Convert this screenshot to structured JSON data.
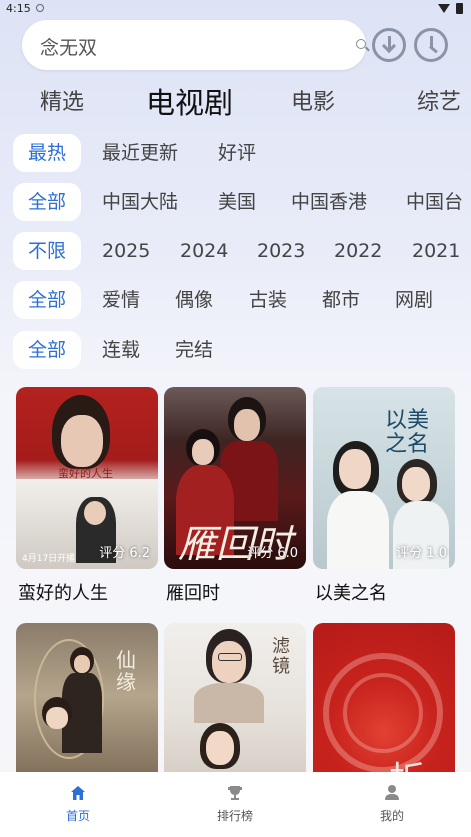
{
  "status": {
    "time": "4:15"
  },
  "search": {
    "value": "念无双"
  },
  "tabs": [
    {
      "label": "精选"
    },
    {
      "label": "电视剧"
    },
    {
      "label": "电影"
    },
    {
      "label": "综艺"
    }
  ],
  "filters": {
    "sort": [
      "最热",
      "最近更新",
      "好评"
    ],
    "region": [
      "全部",
      "中国大陆",
      "美国",
      "中国香港",
      "中国台"
    ],
    "year": [
      "不限",
      "2025",
      "2024",
      "2023",
      "2022",
      "2021"
    ],
    "genre": [
      "全部",
      "爱情",
      "偶像",
      "古装",
      "都市",
      "网剧"
    ],
    "status": [
      "全部",
      "连载",
      "完结"
    ]
  },
  "cards": [
    {
      "title": "蛮好的人生",
      "score": "评分 6.2",
      "poster_text": "蛮好的人生",
      "poster_date": "4月17日开播"
    },
    {
      "title": "雁回时",
      "score": "评分 6.0",
      "poster_text": "雁回时"
    },
    {
      "title": "以美之名",
      "score": "评分 1.0",
      "poster_text": "以美之名"
    },
    {
      "title": "",
      "score": "",
      "poster_text": "仙缘"
    },
    {
      "title": "",
      "score": "",
      "poster_text": "滤镜"
    },
    {
      "title": "",
      "score": "",
      "poster_text": "一折"
    }
  ],
  "bottom_nav": [
    {
      "label": "首页",
      "icon": "home-icon"
    },
    {
      "label": "排行榜",
      "icon": "trophy-icon"
    },
    {
      "label": "我的",
      "icon": "user-icon"
    }
  ],
  "colors": {
    "accent": "#2d6fd6"
  }
}
